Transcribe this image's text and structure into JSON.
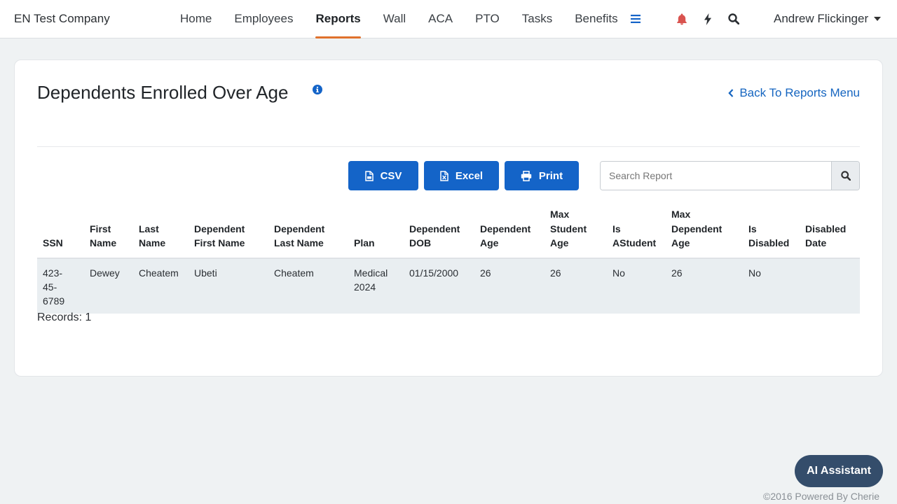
{
  "header": {
    "brand": "EN Test Company",
    "nav": [
      {
        "label": "Home"
      },
      {
        "label": "Employees"
      },
      {
        "label": "Reports",
        "active": true
      },
      {
        "label": "Wall"
      },
      {
        "label": "ACA"
      },
      {
        "label": "PTO"
      },
      {
        "label": "Tasks"
      },
      {
        "label": "Benefits"
      }
    ],
    "icons": [
      "menu-icon",
      "bell-icon",
      "bolt-icon",
      "search-icon"
    ],
    "user_name": "Andrew Flickinger"
  },
  "report": {
    "title": "Dependents Enrolled Over Age",
    "back_label": "Back To Reports Menu",
    "buttons": {
      "csv": "CSV",
      "excel": "Excel",
      "print": "Print"
    },
    "search_placeholder": "Search Report",
    "columns": [
      [
        "SSN"
      ],
      [
        "First",
        "Name"
      ],
      [
        "Last",
        "Name"
      ],
      [
        "Dependent",
        "First Name"
      ],
      [
        "Dependent",
        "Last Name"
      ],
      [
        "Plan"
      ],
      [
        "Dependent",
        "DOB"
      ],
      [
        "Dependent",
        "Age"
      ],
      [
        "Max",
        "Student",
        "Age"
      ],
      [
        "Is",
        "AStudent"
      ],
      [
        "Max",
        "Dependent",
        "Age"
      ],
      [
        "Is",
        "Disabled"
      ],
      [
        "Disabled",
        "Date"
      ]
    ],
    "rows": [
      [
        [
          "423-",
          "45-",
          "6789"
        ],
        [
          "Dewey"
        ],
        [
          "Cheatem"
        ],
        [
          "Ubeti"
        ],
        [
          "Cheatem"
        ],
        [
          "Medical",
          "2024"
        ],
        [
          "01/15/2000"
        ],
        [
          "26"
        ],
        [
          "26"
        ],
        [
          "No"
        ],
        [
          "26"
        ],
        [
          "No"
        ],
        [
          ""
        ]
      ]
    ],
    "records": "Records: 1"
  },
  "ai_assistant_label": "AI Assistant",
  "footer": "©2016 Powered By Cherie",
  "colors": {
    "primary": "#1464c8",
    "active_tab_underline": "#e0712c",
    "bell": "#d9534f",
    "ai_button": "#344d6b",
    "background": "#eff2f3"
  }
}
